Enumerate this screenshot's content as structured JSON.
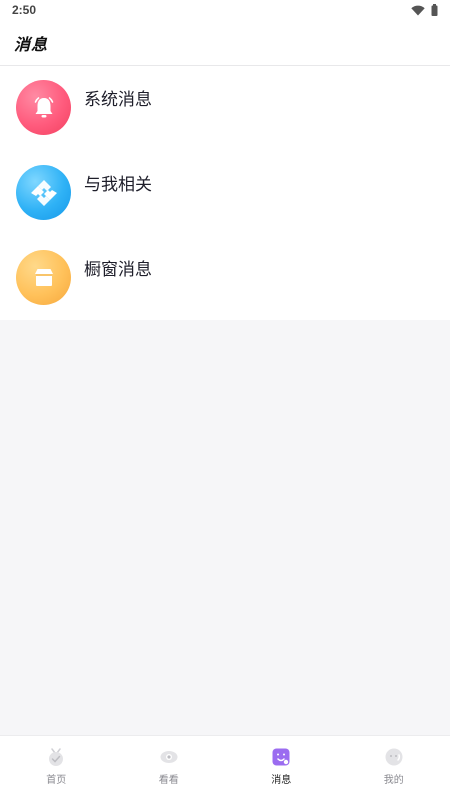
{
  "status_bar": {
    "time": "2:50"
  },
  "header": {
    "title": "消息"
  },
  "messages": [
    {
      "title": "系统消息",
      "icon": "bell-icon",
      "color": "#ff5b7d"
    },
    {
      "title": "与我相关",
      "icon": "link-icon",
      "color": "#2fb2f6"
    },
    {
      "title": "橱窗消息",
      "icon": "shop-icon",
      "color": "#ffc15a"
    }
  ],
  "tabbar": {
    "items": [
      {
        "label": "首页",
        "icon": "home-icon",
        "active": false
      },
      {
        "label": "看看",
        "icon": "eye-icon",
        "active": false
      },
      {
        "label": "消息",
        "icon": "message-icon",
        "active": true
      },
      {
        "label": "我的",
        "icon": "profile-icon",
        "active": false
      }
    ],
    "active_color": "#9b6cf0"
  }
}
